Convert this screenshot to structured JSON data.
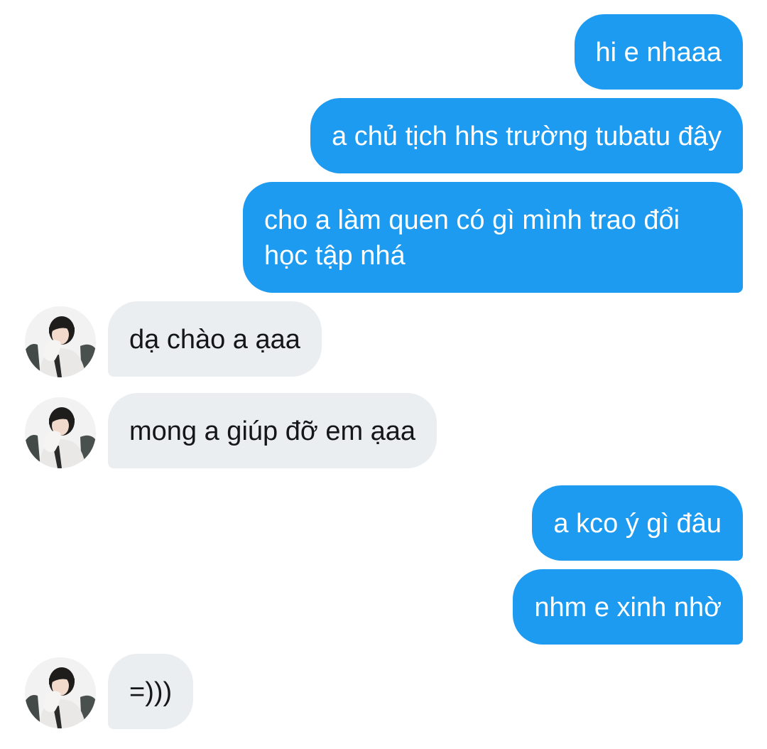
{
  "chat": {
    "messages": [
      {
        "sender": "me",
        "text": "hi e nhaaa"
      },
      {
        "sender": "me",
        "text": "a chủ tịch hhs trường tubatu đây"
      },
      {
        "sender": "me",
        "text": "cho a làm quen có gì mình trao đổi học tập nhá"
      },
      {
        "sender": "them",
        "text": "dạ chào a ạaa"
      },
      {
        "sender": "them",
        "text": "mong a giúp đỡ em ạaa"
      },
      {
        "sender": "me",
        "text": "a kco ý gì đâu"
      },
      {
        "sender": "me",
        "text": "nhm e xinh nhờ"
      },
      {
        "sender": "them",
        "text": "=)))"
      }
    ]
  },
  "colors": {
    "outgoing_bubble": "#1d9bf0",
    "incoming_bubble": "#eaeef1",
    "outgoing_text": "#ffffff",
    "incoming_text": "#141619"
  }
}
